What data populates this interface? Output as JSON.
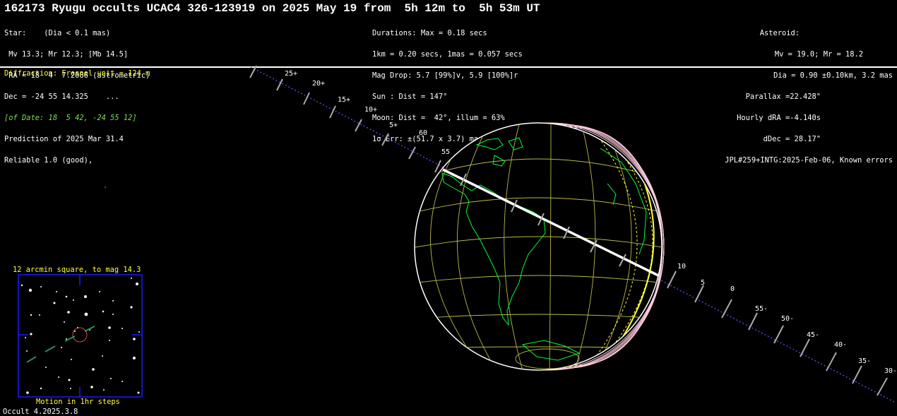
{
  "title": "162173 Ryugu occults UCAC4 326-123919 on 2025 May 19 from  5h 12m to  5h 53m UT",
  "star_block": [
    "Star:    (Dia < 0.1 mas)",
    " Mv 13.3; Mr 12.3; [Mb 14.5]",
    " RA = 18  4  7.2086 (astrometric)",
    "Dec = -24 55 14.325    ...",
    "[of Date: 18  5 42, -24 55 12]",
    "Prediction of 2025 Mar 31.4",
    "Reliable 1.0 (good),"
  ],
  "event_block": [
    "Durations: Max = 0.18 secs",
    "1km = 0.20 secs, 1mas = 0.057 secs",
    "Mag Drop: 5.7 [99%]v, 5.9 [100%]r",
    "Sun : Dist = 147°",
    "Moon: Dist =  42°, illum = 63%",
    "1σ Err: ±(51.7 x 3.7) mas in PA 78°"
  ],
  "asteroid_block": [
    "Asteroid:",
    "Mv = 19.0; Mr = 18.2",
    "Dia = 0.90 ±0.10km, 3.2 mas",
    "Parallax =22.428\"",
    "Hourly dRA =-4.140s",
    "dDec = 28.17\"",
    "JPL#259+INTG:2025-Feb-06, Known errors"
  ],
  "diffraction_text": "Diffraction: Fresnel unit = 124 m",
  "inset": {
    "caption_top": "12 arcmin square, to mag 14.3",
    "caption_bottom": "Motion in 1hr steps"
  },
  "footer": "Occult 4.2025.3.8",
  "path_ticks_upper": [
    "25+",
    "20+",
    "15+",
    "10+",
    "5+",
    "60",
    "55"
  ],
  "path_ticks_lower": [
    "10",
    "5",
    "0",
    "55-",
    "50-",
    "45-",
    "40-",
    "35-",
    "30-"
  ],
  "colors": {
    "background": "#000000",
    "text": "#ffffff",
    "highlight": "#ffff33",
    "coastline": "#00ff33",
    "grid": "#b8b84a",
    "path": "#8844ff",
    "inset_frame": "#1a1aff",
    "shadow_track": "#ffffff"
  }
}
